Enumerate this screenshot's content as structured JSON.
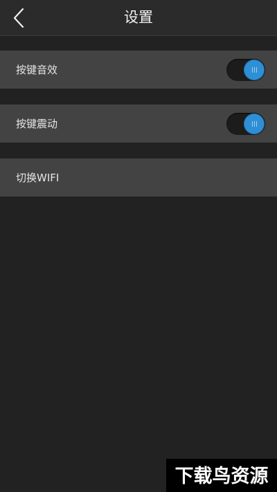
{
  "header": {
    "title": "设置",
    "back_icon": "chevron-left-icon"
  },
  "settings": {
    "items": [
      {
        "label": "按键音效",
        "toggle": "on"
      },
      {
        "label": "按键震动",
        "toggle": "on"
      },
      {
        "label": "切换WIFI"
      }
    ]
  },
  "colors": {
    "background": "#222222",
    "row": "#434343",
    "accent": "#2f8fd4"
  },
  "watermark": {
    "text": "下载鸟资源"
  }
}
